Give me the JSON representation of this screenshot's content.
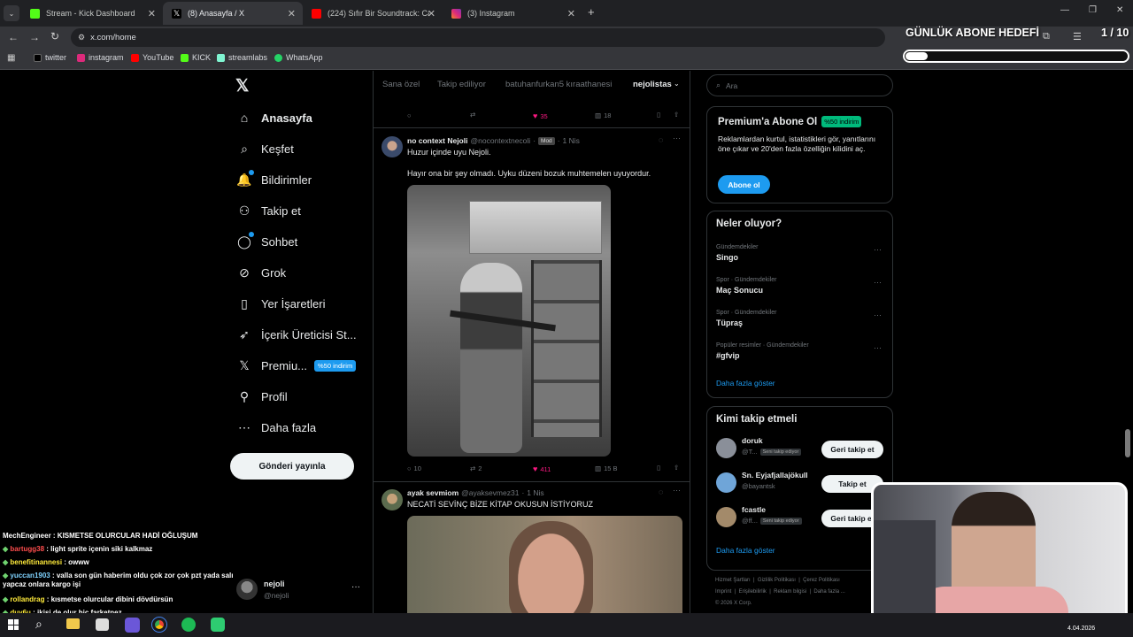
{
  "tabs": [
    {
      "title": "Stream - Kick Dashboard",
      "color": "#53fc18"
    },
    {
      "title": "(8) Anasayfa / X",
      "color": "#000000"
    },
    {
      "title": "(224) Sıfır Bir Soundtrack: Cash",
      "color": "#ff0000"
    },
    {
      "title": "(3) Instagram",
      "color": "#e1306c"
    }
  ],
  "address": "x.com/home",
  "bookmarks": [
    "twitter",
    "instagram",
    "YouTube",
    "KICK",
    "streamlabs",
    "WhatsApp"
  ],
  "overlay": {
    "goal_label": "GÜNLÜK ABONE HEDEFİ",
    "goal_value": "1 / 10",
    "goal_fraction": 0.1
  },
  "nav": {
    "items": [
      {
        "label": "Anasayfa",
        "icon": "home-icon"
      },
      {
        "label": "Keşfet",
        "icon": "search-icon"
      },
      {
        "label": "Bildirimler",
        "icon": "bell-icon"
      },
      {
        "label": "Takip et",
        "icon": "person-add-icon"
      },
      {
        "label": "Sohbet",
        "icon": "chat-icon"
      },
      {
        "label": "Grok",
        "icon": "grok-icon"
      },
      {
        "label": "Yer İşaretleri",
        "icon": "bookmark-icon"
      },
      {
        "label": "İçerik Üreticisi St...",
        "icon": "rocket-icon"
      },
      {
        "label": "Premiu...",
        "icon": "x-logo-icon"
      },
      {
        "label": "Profil",
        "icon": "profile-icon"
      },
      {
        "label": "Daha fazla",
        "icon": "more-icon"
      }
    ],
    "premium_badge": "%50 indirim",
    "post_button": "Gönderi yayınla",
    "account": {
      "name": "nejoli",
      "handle": "@nejoli"
    }
  },
  "feed": {
    "tabs": [
      "Sana özel",
      "Takip ediliyor",
      "batuhanfurkan5 kıraathanesi",
      "nejolistas"
    ],
    "prev_actions": {
      "likes": "35",
      "views": "18"
    },
    "post1": {
      "name": "no context Nejoli",
      "handle": "@nocontextnecoli",
      "badge": "Mod",
      "time": "1 Nis",
      "text1": "Huzur içinde uyu Nejoli.",
      "text2": "Hayır ona bir şey olmadı. Uyku düzeni bozuk muhtemelen uyuyordur.",
      "replies": "10",
      "reposts": "2",
      "likes": "411",
      "views": "15 B"
    },
    "post2": {
      "name": "ayak sevmiom",
      "handle": "@ayaksevmez31",
      "time": "1 Nis",
      "text": "NECATİ SEVİNÇ BİZE KİTAP OKUSUN İSTİYORUZ"
    }
  },
  "right": {
    "search_placeholder": "Ara",
    "premium": {
      "title": "Premium'a Abone Ol",
      "badge": "%50 indirim",
      "text": "Reklamlardan kurtul, istatistikleri gör, yanıtlarını öne çıkar ve 20'den fazla özelliğin kilidini aç.",
      "button": "Abone ol"
    },
    "trends_title": "Neler oluyor?",
    "trends": [
      {
        "category": "Gündemdekiler",
        "name": "Singo"
      },
      {
        "category": "Spor · Gündemdekiler",
        "name": "Maç Sonucu"
      },
      {
        "category": "Spor · Gündemdekiler",
        "name": "Tüpraş"
      },
      {
        "category": "Popüler resimler · Gündemdekiler",
        "name": "#gfvip"
      }
    ],
    "show_more": "Daha fazla göster",
    "who_title": "Kimi takip etmeli",
    "who": [
      {
        "name": "doruk",
        "handle": "@T...",
        "tag": "Seni takip ediyor",
        "button": "Geri takip et"
      },
      {
        "name": "Sn. Eyjafjallajökull",
        "handle": "@bayantsk",
        "tag": "",
        "button": "Takip et"
      },
      {
        "name": "fcastle",
        "handle": "@ff...",
        "tag": "Seni takip ediyor",
        "button": "Geri takip et"
      }
    ],
    "who_more": "Daha fazla göster",
    "footer": [
      "Hizmet Şartları",
      "Gizlilik Politikası",
      "Çerez Politikası",
      "Imprint",
      "Erişilebilirlik",
      "Reklam bilgisi",
      "Daha fazla ...",
      "© 2026 X Corp."
    ]
  },
  "chat": [
    {
      "user": "MechEngineer",
      "msg": " : KISMETSE OLURCULAR HADİ OĞLUŞUM",
      "color": "#ffffff"
    },
    {
      "user": "bartugg38",
      "msg": " : light sprite içenin siki kalkmaz",
      "color": "#ff4d4d"
    },
    {
      "user": "benefitinannesi",
      "msg": " : owww",
      "color": "#ffeb3b"
    },
    {
      "user": "yuccan1903",
      "msg": " : valla son gün haberim oldu çok zor çok pzt yada salı yapcaz onlara kargo işi",
      "color": "#7fd3ff"
    },
    {
      "user": "rollandrag",
      "msg": " : kısmetse olurcular dibini dövdürsün",
      "color": "#ffeb3b"
    },
    {
      "user": "duy6u",
      "msg": " : ikisi de olur hiç farketnez",
      "color": "#ffeb3b"
    }
  ],
  "taskbar": {
    "time": "4.04.2026"
  }
}
